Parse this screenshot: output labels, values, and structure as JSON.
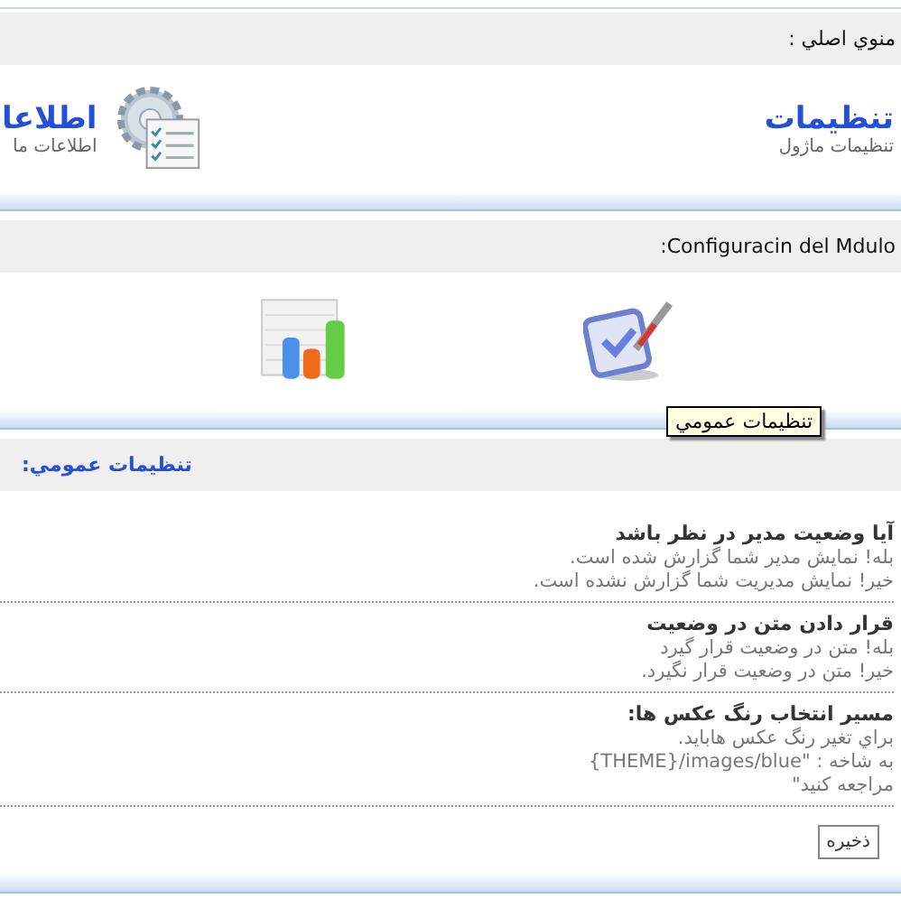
{
  "main_menu": {
    "header": "منوي اصلي :",
    "items": [
      {
        "kind": "settings",
        "title": "تنظيمات",
        "subtitle": "تنظيمات ماژول"
      },
      {
        "kind": "info",
        "title": "اطلاعا",
        "subtitle": "اطلاعات ما"
      }
    ]
  },
  "config": {
    "header": "Configuracin del Mdulo:",
    "icons": [
      {
        "kind": "check"
      },
      {
        "kind": "chart"
      }
    ],
    "tooltip": "تنظيمات عمومي"
  },
  "general": {
    "header": "تنظيمات عمومي:",
    "settings": [
      {
        "title": "آيا وضعيت مدير در نظر باشد",
        "lines": [
          "بله! نمايش مدير شما گزارش شده است.",
          "خير! نمايش مديريت شما گزارش نشده است."
        ]
      },
      {
        "title": "قرار دادن متن در وضعيت",
        "lines": [
          "بله! متن در وضعيت قرار گيرد",
          "خير! متن در وضعيت قرار نگيرد."
        ]
      },
      {
        "title": "مسير انتخاب رنگ عكس ها:",
        "lines": [
          "براي تغير رنگ عكس هابايد.",
          "به شاخه : \"THEME}/images/blue}",
          "مراجعه كنيد\""
        ]
      }
    ],
    "save_button": "ذخيره"
  }
}
